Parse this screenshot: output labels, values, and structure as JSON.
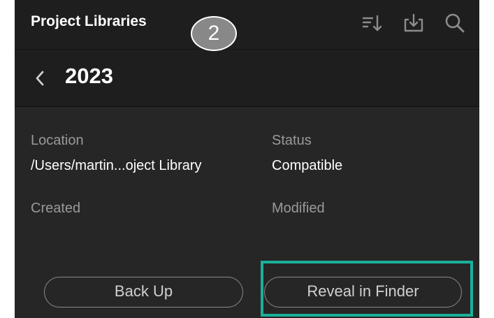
{
  "header": {
    "title": "Project Libraries",
    "step_badge": "2",
    "icons": [
      "sort-icon",
      "import-icon",
      "search-icon"
    ]
  },
  "subheader": {
    "folder_name": "2023"
  },
  "info": {
    "location_label": "Location",
    "location_value": "/Users/martin...oject Library",
    "status_label": "Status",
    "status_value": "Compatible",
    "created_label": "Created",
    "modified_label": "Modified"
  },
  "actions": {
    "back_up_label": "Back Up",
    "reveal_label": "Reveal in Finder"
  },
  "colors": {
    "panel_bg": "#262626",
    "header_bg": "#1e1e1e",
    "highlight": "#1ab09a",
    "badge": "#888888"
  }
}
